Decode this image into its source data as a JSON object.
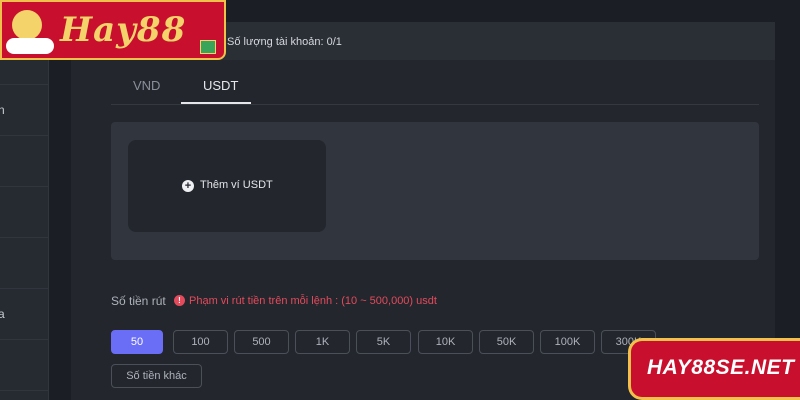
{
  "brand": {
    "logo_text": "Hay88",
    "domain": "HAY88SE.NET"
  },
  "sidebar": {
    "items": [
      {
        "label": ""
      },
      {
        "label": "n"
      },
      {
        "label": ""
      },
      {
        "label": ""
      },
      {
        "label": ""
      },
      {
        "label": "a"
      },
      {
        "label": ""
      }
    ]
  },
  "account": {
    "count_text": "Số lượng tài khoản:  0/1"
  },
  "tabs": [
    {
      "label": "VND",
      "active": false
    },
    {
      "label": "USDT",
      "active": true
    }
  ],
  "wallet": {
    "add_label": "Thêm ví USDT",
    "add_icon": "plus-circle-icon"
  },
  "amount": {
    "label": "Số tiền rút",
    "info_icon": "info-icon",
    "info_glyph": "!",
    "range_text": "Phạm vi rút tiền trên mỗi lệnh : (10 ~ 500,000) usdt",
    "options": [
      {
        "label": "50",
        "active": true
      },
      {
        "label": "100",
        "active": false
      },
      {
        "label": "500",
        "active": false
      },
      {
        "label": "1K",
        "active": false
      },
      {
        "label": "5K",
        "active": false
      },
      {
        "label": "10K",
        "active": false
      },
      {
        "label": "50K",
        "active": false
      },
      {
        "label": "100K",
        "active": false
      },
      {
        "label": "300K",
        "active": false
      }
    ],
    "other_label": "Số tiền khác"
  },
  "colors": {
    "accent": "#6a6df5",
    "danger": "#e34b5c",
    "brand_red": "#c8102e",
    "brand_gold": "#f0c14b"
  }
}
